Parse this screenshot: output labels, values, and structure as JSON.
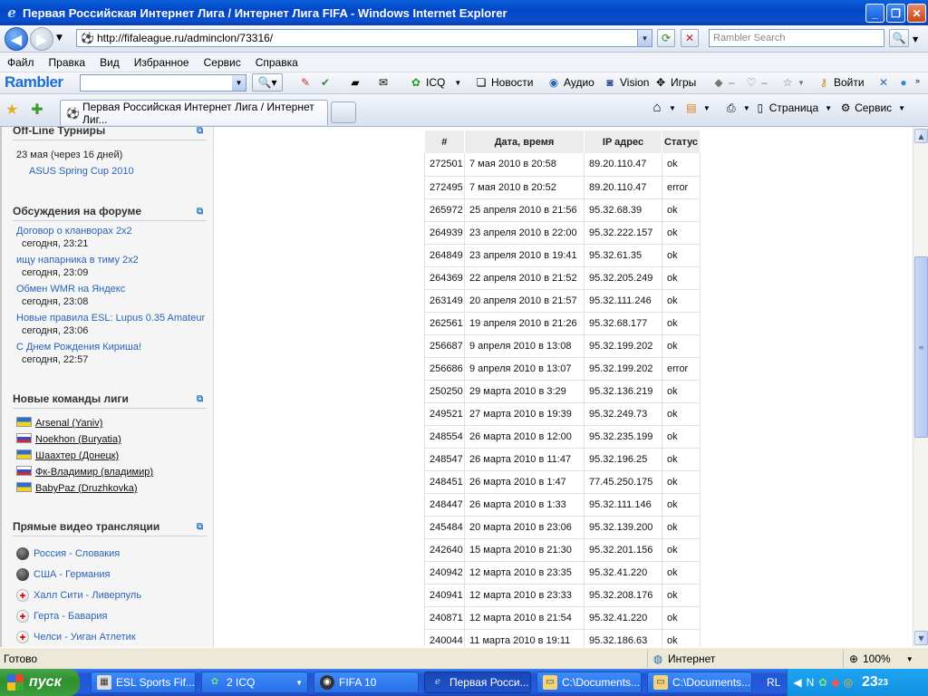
{
  "window": {
    "title": "Первая Российская Интернет Лига / Интернет Лига FIFA - Windows Internet Explorer"
  },
  "address": {
    "url": "http://fifaleague.ru/adminclon/73316/",
    "search_placeholder": "Rambler Search"
  },
  "menu": [
    "Файл",
    "Правка",
    "Вид",
    "Избранное",
    "Сервис",
    "Справка"
  ],
  "rambler_bar": {
    "logo": "Rambler",
    "items": [
      "ICQ",
      "Новости",
      "Аудио",
      "Vision",
      "Игры",
      "Войти"
    ]
  },
  "tab": {
    "label": "Первая Российская Интернет Лига / Интернет Лиг..."
  },
  "command_bar": {
    "page": "Страница",
    "tools": "Сервис"
  },
  "sidebar": {
    "offline": {
      "heading": "Off-Line Турниры",
      "date": "23 мая (через 16 дней)",
      "link": "ASUS Spring Cup 2010"
    },
    "forum": {
      "heading": "Обсуждения на форуме",
      "items": [
        {
          "title": "Договор о кланворах 2х2",
          "time": "сегодня, 23:21"
        },
        {
          "title": "ищу напарника в тиму 2х2",
          "time": "сегодня, 23:09"
        },
        {
          "title": "Обмен WMR на Яндекс",
          "time": "сегодня, 23:08"
        },
        {
          "title": "Новые правила ESL: Lupus 0.35 Amateur",
          "time": "сегодня, 23:06"
        },
        {
          "title": "С Днем Рождения Кириша!",
          "time": "сегодня, 22:57"
        }
      ]
    },
    "teams": {
      "heading": "Новые команды лиги",
      "items": [
        {
          "name": "Arsenal (Yaniv)",
          "flag": "ua"
        },
        {
          "name": "Noekhon (Buryatia)",
          "flag": "ru"
        },
        {
          "name": "Шаахтер (Донецк)",
          "flag": "ua"
        },
        {
          "name": "Фк-Владимир (владимир)",
          "flag": "ru"
        },
        {
          "name": "BabyPaz (Druzhkovka)",
          "flag": "ua"
        }
      ]
    },
    "video": {
      "heading": "Прямые видео трансляции",
      "items": [
        {
          "title": "Россия - Словакия",
          "icon": "hockey-puck-icon"
        },
        {
          "title": "США - Германия",
          "icon": "hockey-puck-icon"
        },
        {
          "title": "Халл Сити - Ливерпуль",
          "icon": "football-icon"
        },
        {
          "title": "Герта - Бавария",
          "icon": "football-icon"
        },
        {
          "title": "Челси - Уиган Атлетик",
          "icon": "football-icon"
        }
      ]
    }
  },
  "log_table": {
    "headers": [
      "#",
      "Дата, время",
      "IP адрес",
      "Статус"
    ],
    "rows": [
      [
        "272501",
        "7 мая 2010 в 20:58",
        "89.20.110.47",
        "ok"
      ],
      [
        "272495",
        "7 мая 2010 в 20:52",
        "89.20.110.47",
        "error"
      ],
      [
        "265972",
        "25 апреля 2010 в 21:56",
        "95.32.68.39",
        "ok"
      ],
      [
        "264939",
        "23 апреля 2010 в 22:00",
        "95.32.222.157",
        "ok"
      ],
      [
        "264849",
        "23 апреля 2010 в 19:41",
        "95.32.61.35",
        "ok"
      ],
      [
        "264369",
        "22 апреля 2010 в 21:52",
        "95.32.205.249",
        "ok"
      ],
      [
        "263149",
        "20 апреля 2010 в 21:57",
        "95.32.111.246",
        "ok"
      ],
      [
        "262561",
        "19 апреля 2010 в 21:26",
        "95.32.68.177",
        "ok"
      ],
      [
        "256687",
        "9 апреля 2010 в 13:08",
        "95.32.199.202",
        "ok"
      ],
      [
        "256686",
        "9 апреля 2010 в 13:07",
        "95.32.199.202",
        "error"
      ],
      [
        "250250",
        "29 марта 2010 в 3:29",
        "95.32.136.219",
        "ok"
      ],
      [
        "249521",
        "27 марта 2010 в 19:39",
        "95.32.249.73",
        "ok"
      ],
      [
        "248554",
        "26 марта 2010 в 12:00",
        "95.32.235.199",
        "ok"
      ],
      [
        "248547",
        "26 марта 2010 в 11:47",
        "95.32.196.25",
        "ok"
      ],
      [
        "248451",
        "26 марта 2010 в 1:47",
        "77.45.250.175",
        "ok"
      ],
      [
        "248447",
        "26 марта 2010 в 1:33",
        "95.32.111.146",
        "ok"
      ],
      [
        "245484",
        "20 марта 2010 в 23:06",
        "95.32.139.200",
        "ok"
      ],
      [
        "242640",
        "15 марта 2010 в 21:30",
        "95.32.201.156",
        "ok"
      ],
      [
        "240942",
        "12 марта 2010 в 23:35",
        "95.32.41.220",
        "ok"
      ],
      [
        "240941",
        "12 марта 2010 в 23:33",
        "95.32.208.176",
        "ok"
      ],
      [
        "240871",
        "12 марта 2010 в 21:54",
        "95.32.41.220",
        "ok"
      ],
      [
        "240044",
        "11 марта 2010 в 19:11",
        "95.32.186.63",
        "ok"
      ]
    ]
  },
  "status_bar": {
    "text": "Готово",
    "zone": "Интернет",
    "zoom": "100%"
  },
  "taskbar": {
    "start": "пуск",
    "buttons": [
      {
        "label": "ESL Sports Fif...",
        "active": false
      },
      {
        "label": "2 ICQ",
        "active": false
      },
      {
        "label": "FIFA 10",
        "active": false
      },
      {
        "label": "Первая Росси...",
        "active": true
      },
      {
        "label": "C:\\Documents...",
        "active": false
      },
      {
        "label": "C:\\Documents...",
        "active": false
      }
    ],
    "lang": "RL",
    "clock": "23",
    "clock_small": "23"
  }
}
